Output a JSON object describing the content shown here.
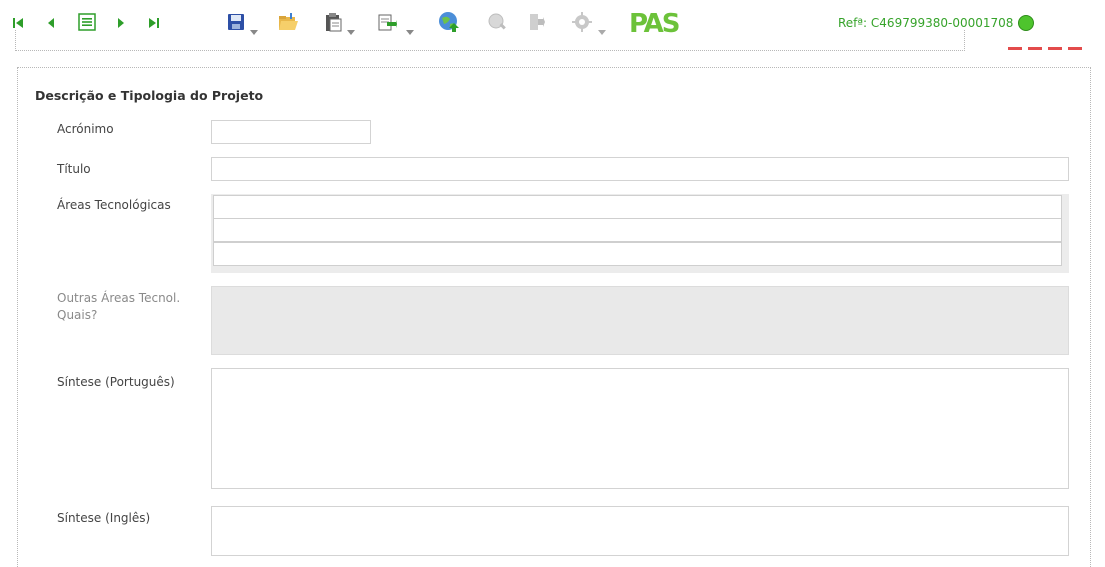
{
  "toolbar": {
    "nav": [
      "first-record",
      "previous-record",
      "record-list",
      "next-record",
      "last-record"
    ],
    "actions": [
      "save",
      "open-folder",
      "paste",
      "export",
      "submit-globe",
      "search",
      "exit",
      "settings"
    ],
    "logo_text": "PAS",
    "reference": "Refª: C469799380-00001708",
    "status_color": "#4ec42d"
  },
  "section": {
    "title": "Descrição e Tipologia do Projeto",
    "fields": {
      "acronimo": {
        "label": "Acrónimo",
        "value": ""
      },
      "titulo": {
        "label": "Título",
        "value": ""
      },
      "areas": {
        "label": "Áreas Tecnológicas",
        "rows": [
          "",
          "",
          ""
        ]
      },
      "outras": {
        "label_line1": "Outras Áreas Tecnol.",
        "label_line2": "Quais?",
        "value": ""
      },
      "sintese_pt": {
        "label": "Síntese (Português)",
        "value": ""
      },
      "sintese_en": {
        "label": "Síntese (Inglês)",
        "value": ""
      }
    }
  },
  "colors": {
    "accent_green": "#36a32a",
    "nav_green": "#2e9e2a",
    "red_deco": "#e34b4b"
  }
}
